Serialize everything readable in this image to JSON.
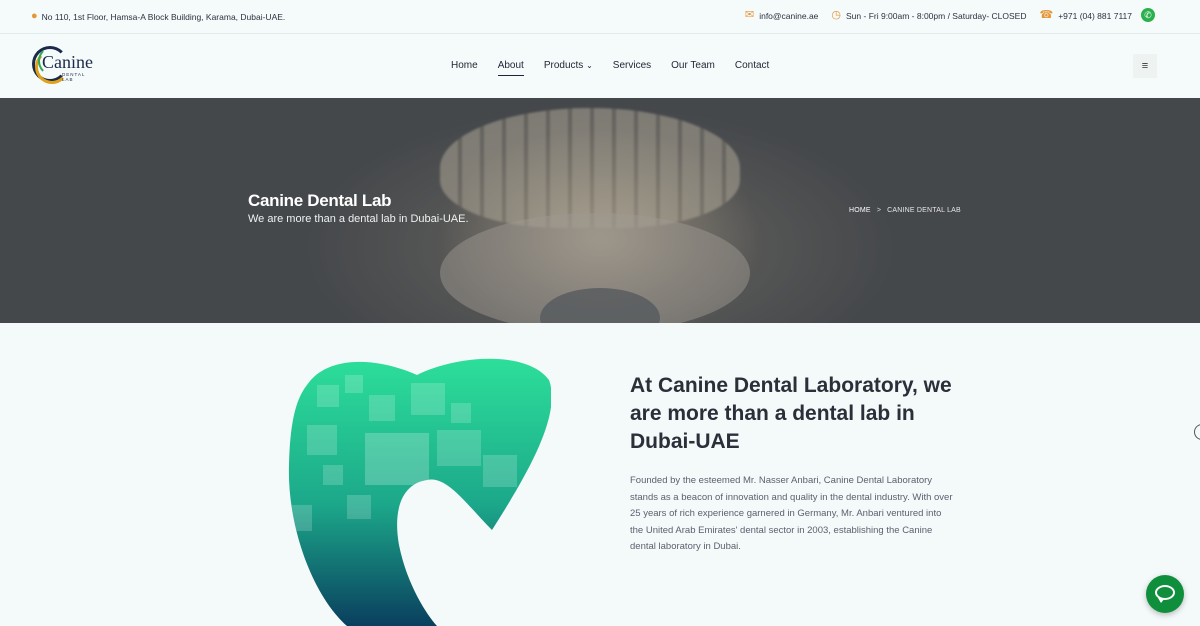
{
  "topbar": {
    "address": "No 110, 1st Floor, Hamsa-A Block Building, Karama, Dubai-UAE.",
    "email": "info@canine.ae",
    "hours": "Sun - Fri 9:00am - 8:00pm / Saturday- CLOSED",
    "phone": "+971 (04) 881 7117"
  },
  "logo": {
    "brand": "Canine",
    "subtitle": "DENTAL LAB"
  },
  "nav": {
    "items": [
      {
        "label": "Home"
      },
      {
        "label": "About"
      },
      {
        "label": "Products"
      },
      {
        "label": "Services"
      },
      {
        "label": "Our Team"
      },
      {
        "label": "Contact"
      }
    ],
    "active": "About",
    "menu_icon": "hamburger-icon"
  },
  "hero": {
    "title": "Canine Dental Lab",
    "tagline": "We are more than a dental lab in Dubai-UAE.",
    "breadcrumb": {
      "home": "HOME",
      "current": "CANINE DENTAL LAB"
    }
  },
  "about": {
    "title": "At Canine Dental Laboratory, we are more than a dental lab in Dubai-UAE",
    "paragraph": "Founded by the esteemed Mr. Nasser Anbari, Canine Dental Laboratory stands as a beacon of innovation and quality in the dental industry. With over 25 years of rich experience garnered in Germany, Mr. Anbari ventured into the United Arab Emirates' dental sector in 2003, establishing the Canine dental laboratory in Dubai."
  },
  "colors": {
    "accent_orange": "#e5963a",
    "whatsapp_green": "#2ab14d",
    "chat_green": "#0f8f3b",
    "tooth_gradient_top": "#2de09a",
    "tooth_gradient_bottom": "#0a3f5e"
  }
}
